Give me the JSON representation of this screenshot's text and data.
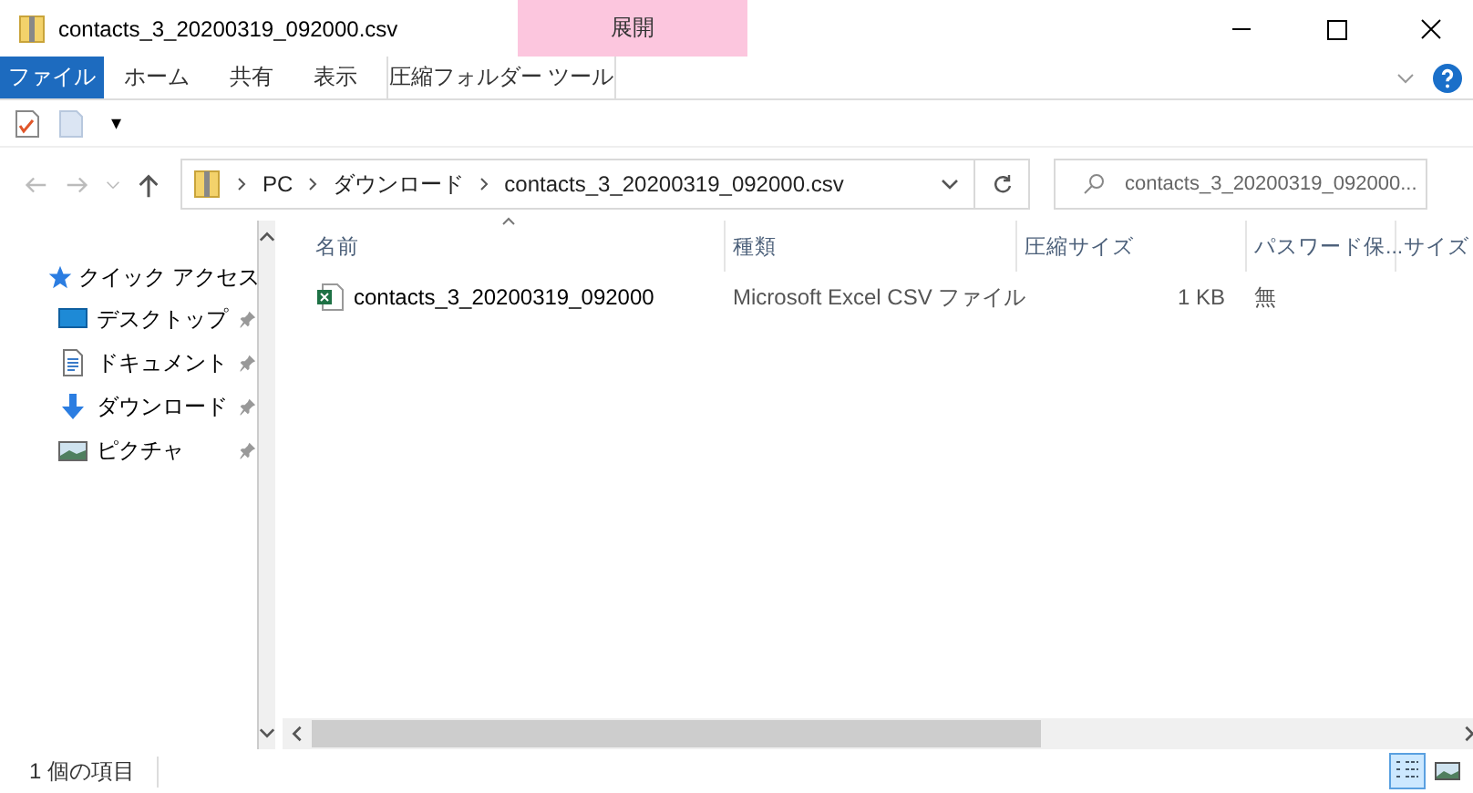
{
  "window": {
    "title": "contacts_3_20200319_092000.csv",
    "context_group": "展開"
  },
  "ribbon_tabs": [
    {
      "label": "ファイル",
      "kind": "file"
    },
    {
      "label": "ホーム",
      "kind": "tab"
    },
    {
      "label": "共有",
      "kind": "tab"
    },
    {
      "label": "表示",
      "kind": "tab"
    },
    {
      "label": "圧縮フォルダー ツール",
      "kind": "context"
    }
  ],
  "quick_access_toolbar": {
    "customize_glyph": "▾"
  },
  "address_bar": {
    "crumbs": [
      "PC",
      "ダウンロード",
      "contacts_3_20200319_092000.csv"
    ]
  },
  "search": {
    "placeholder": "contacts_3_20200319_092000..."
  },
  "sidebar": {
    "header": "クイック アクセス",
    "items": [
      {
        "label": "デスクトップ",
        "kind": "desktop",
        "pinned": true
      },
      {
        "label": "ドキュメント",
        "kind": "documents",
        "pinned": true
      },
      {
        "label": "ダウンロード",
        "kind": "downloads",
        "pinned": true
      },
      {
        "label": "ピクチャ",
        "kind": "pictures",
        "pinned": true
      }
    ]
  },
  "table": {
    "columns": [
      {
        "label": "名前",
        "sorted": true
      },
      {
        "label": "種類",
        "sorted": false
      },
      {
        "label": "圧縮サイズ",
        "sorted": false
      },
      {
        "label": "パスワード保...",
        "sorted": false
      },
      {
        "label": "サイズ",
        "sorted": false
      }
    ],
    "rows": [
      {
        "cells": [
          "contacts_3_20200319_092000",
          "Microsoft Excel CSV ファイル",
          "1 KB",
          "無"
        ],
        "selected": false
      }
    ]
  },
  "status_bar": {
    "text": "1 個の項目",
    "views": [
      {
        "kind": "details",
        "selected": true
      },
      {
        "kind": "large_icons",
        "selected": false
      }
    ]
  }
}
